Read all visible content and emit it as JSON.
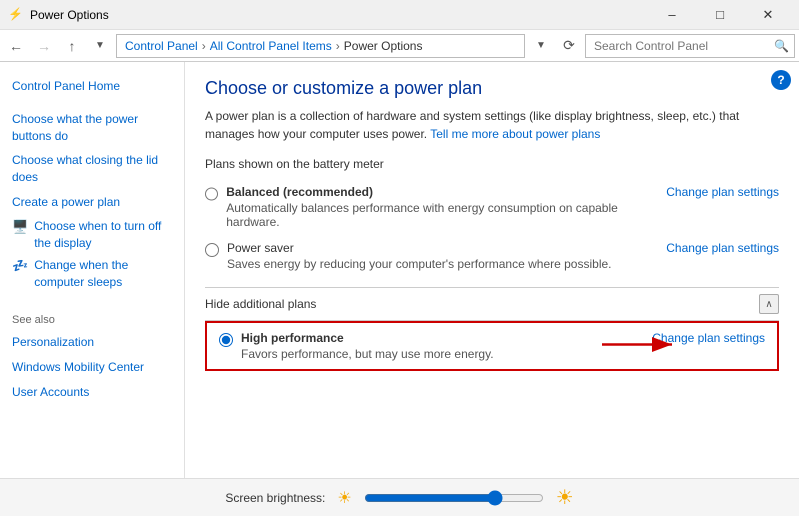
{
  "titleBar": {
    "icon": "⚡",
    "title": "Power Options",
    "minimizeLabel": "–",
    "maximizeLabel": "□",
    "closeLabel": "✕"
  },
  "addressBar": {
    "backDisabled": false,
    "forwardDisabled": true,
    "upDisabled": false,
    "path": {
      "controlPanel": "Control Panel",
      "allItems": "All Control Panel Items",
      "current": "Power Options"
    },
    "refreshTitle": "Refresh",
    "searchPlaceholder": "Search Control Panel"
  },
  "sidebar": {
    "links": [
      {
        "id": "control-panel-home",
        "label": "Control Panel Home",
        "icon": null
      },
      {
        "id": "power-buttons",
        "label": "Choose what the power buttons do",
        "icon": null
      },
      {
        "id": "closing-lid",
        "label": "Choose what closing the lid does",
        "icon": null
      },
      {
        "id": "create-plan",
        "label": "Create a power plan",
        "icon": null
      },
      {
        "id": "turn-off-display",
        "label": "Choose when to turn off the display",
        "icon": "🖥️"
      },
      {
        "id": "change-sleep",
        "label": "Change when the computer sleeps",
        "icon": "💤"
      }
    ],
    "seeAlso": {
      "title": "See also",
      "links": [
        {
          "id": "personalization",
          "label": "Personalization"
        },
        {
          "id": "mobility-center",
          "label": "Windows Mobility Center"
        },
        {
          "id": "user-accounts",
          "label": "User Accounts"
        }
      ]
    }
  },
  "content": {
    "title": "Choose or customize a power plan",
    "description": "A power plan is a collection of hardware and system settings (like display brightness, sleep, etc.) that manages how your computer uses power.",
    "linkText": "Tell me more about power plans",
    "batteryLabel": "Plans shown on the battery meter",
    "plans": [
      {
        "id": "balanced",
        "name": "Balanced (recommended)",
        "description": "Automatically balances performance with energy consumption on capable hardware.",
        "selected": false,
        "changeLinkText": "Change plan settings"
      },
      {
        "id": "power-saver",
        "name": "Power saver",
        "description": "Saves energy by reducing your computer's performance where possible.",
        "selected": false,
        "changeLinkText": "Change plan settings"
      }
    ],
    "additionalPlans": {
      "label": "Hide additional plans",
      "plans": [
        {
          "id": "high-performance",
          "name": "High performance",
          "description": "Favors performance, but may use more energy.",
          "selected": true,
          "changeLinkText": "Change plan settings"
        }
      ]
    }
  },
  "bottomBar": {
    "label": "Screen brightness:",
    "sliderValue": 75
  }
}
